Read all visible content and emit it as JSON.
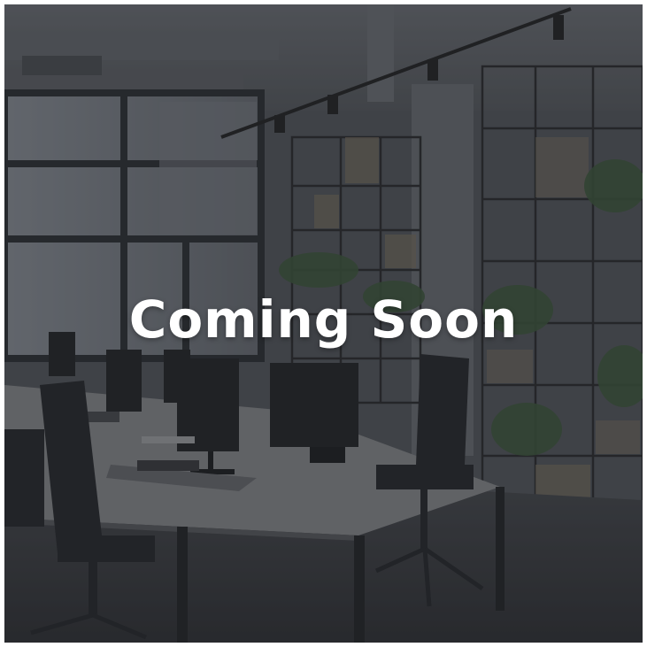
{
  "headline": "Coming Soon",
  "colors": {
    "text": "#ffffff",
    "overlay": "#1e2024"
  }
}
